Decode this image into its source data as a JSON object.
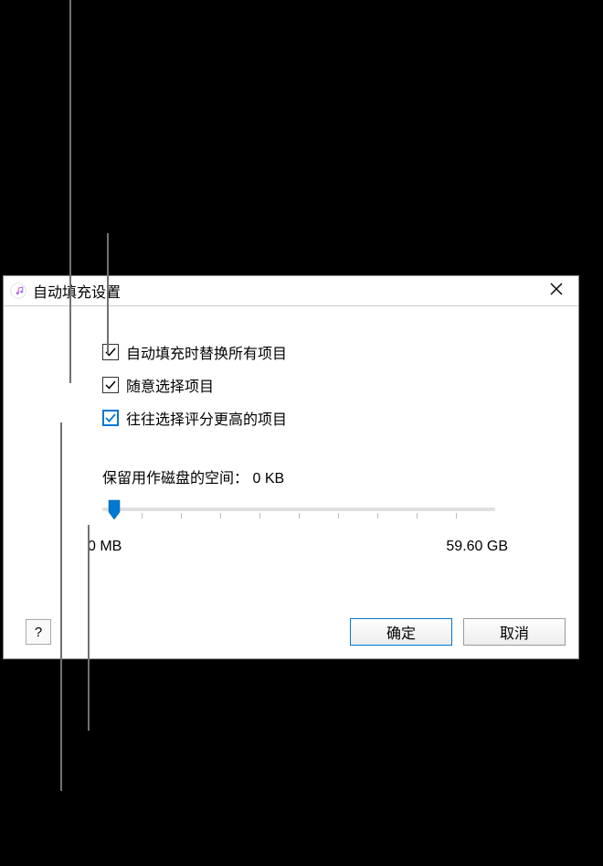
{
  "dialog": {
    "title": "自动填充设置",
    "checkboxes": [
      {
        "label": "自动填充时替换所有项目",
        "checked": true,
        "highlight": false
      },
      {
        "label": "随意选择项目",
        "checked": true,
        "highlight": false
      },
      {
        "label": "往往选择评分更高的项目",
        "checked": true,
        "highlight": true
      }
    ],
    "slider": {
      "label_prefix": "保留用作磁盘的空间：",
      "value_text": "0 KB",
      "min_label": "0 MB",
      "max_label": "59.60 GB"
    },
    "buttons": {
      "help": "?",
      "ok": "确定",
      "cancel": "取消"
    }
  }
}
